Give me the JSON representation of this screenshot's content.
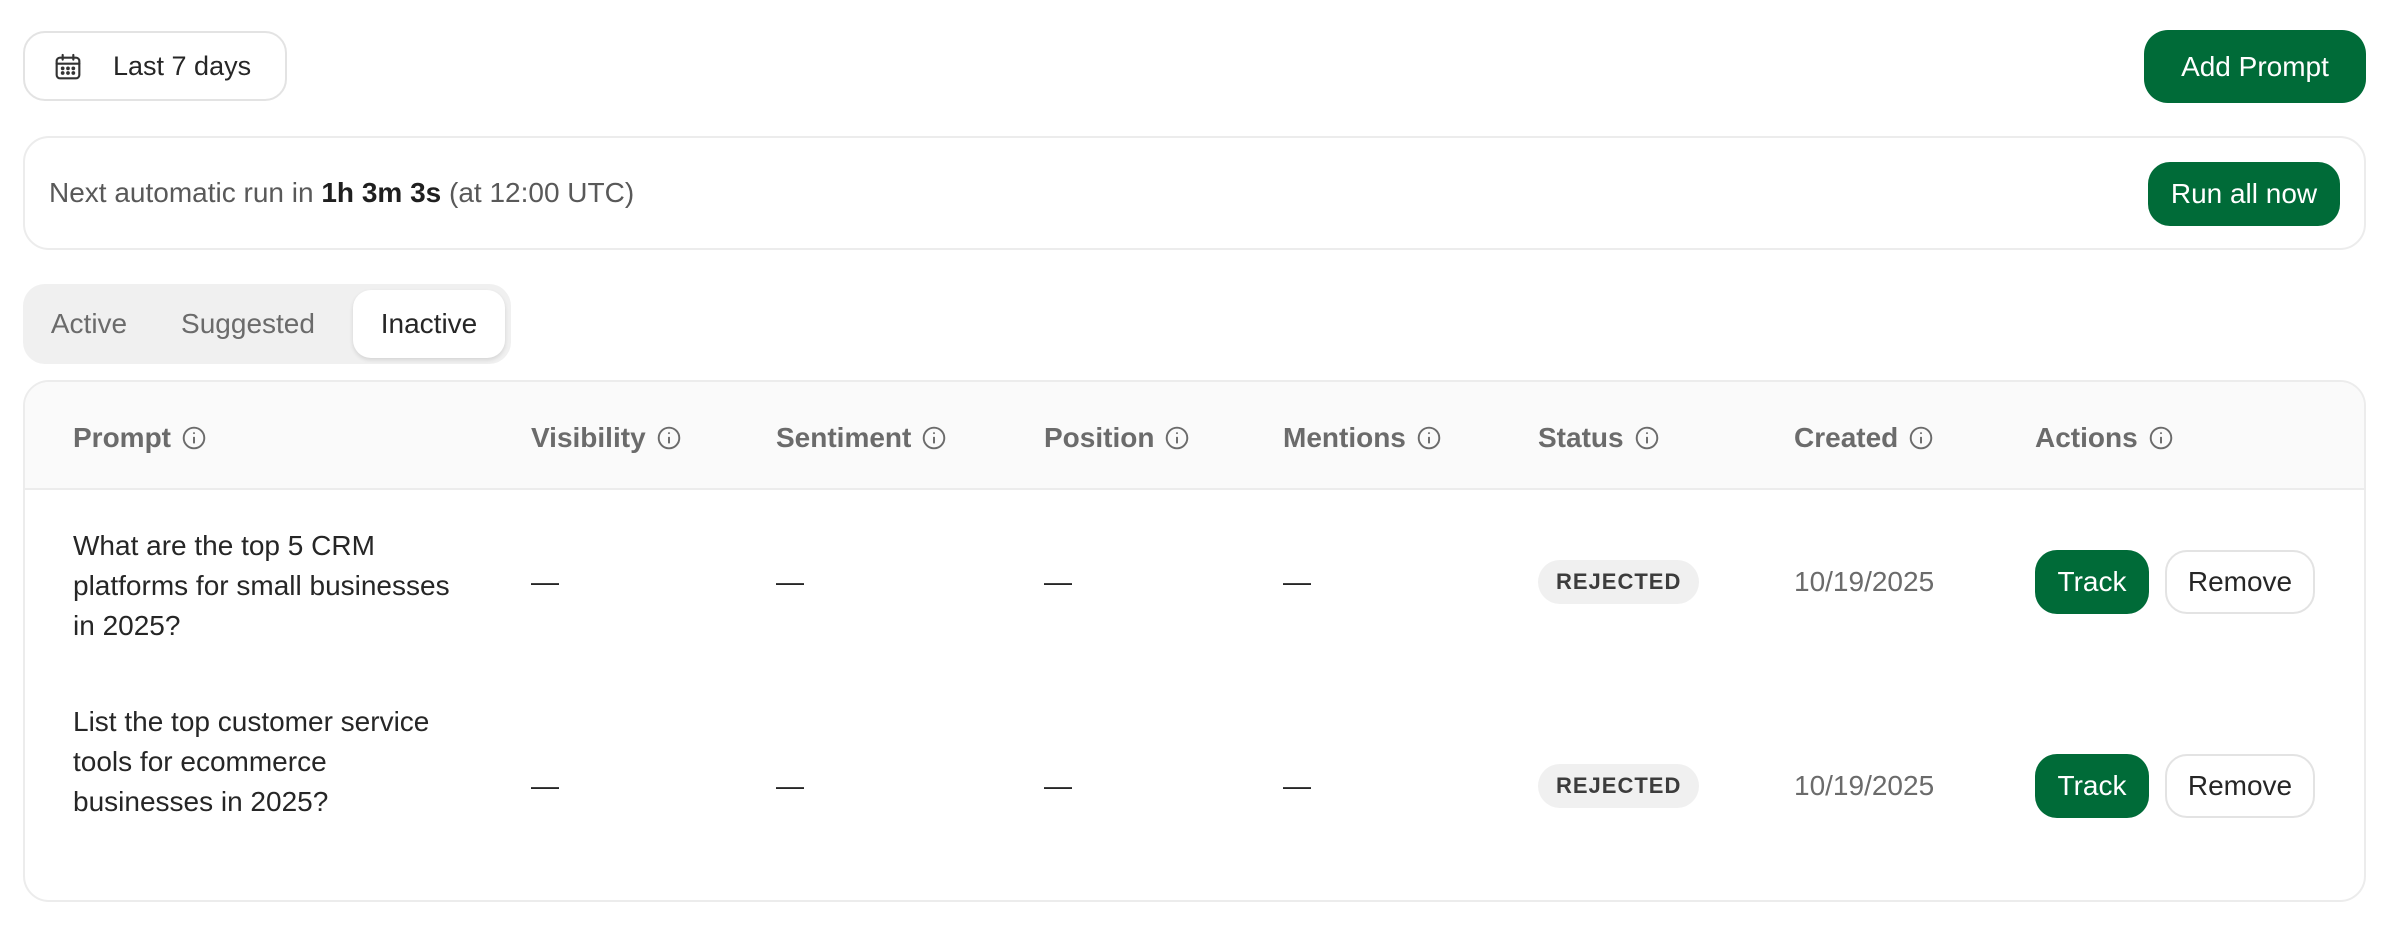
{
  "toolbar": {
    "date_range_label": "Last 7 days",
    "date_icon": "calendar-icon",
    "add_prompt_label": "Add Prompt"
  },
  "schedule": {
    "prefix": "Next automatic run in",
    "countdown": "1h 3m 3s",
    "suffix": "(at 12:00 UTC)",
    "run_all_label": "Run all now"
  },
  "tabs": [
    {
      "label": "Active",
      "selected": false
    },
    {
      "label": "Suggested",
      "selected": false
    },
    {
      "label": "Inactive",
      "selected": true
    }
  ],
  "table": {
    "columns": [
      "Prompt",
      "Visibility",
      "Sentiment",
      "Position",
      "Mentions",
      "Status",
      "Created",
      "Actions"
    ],
    "info_icon": "info-icon",
    "rows": [
      {
        "prompt": "What are the top 5 CRM platforms for small businesses in 2025?",
        "visibility": "—",
        "sentiment": "—",
        "position": "—",
        "mentions": "—",
        "status": "REJECTED",
        "created": "10/19/2025",
        "track_label": "Track",
        "remove_label": "Remove"
      },
      {
        "prompt": "List the top customer service tools for ecommerce businesses in 2025?",
        "visibility": "—",
        "sentiment": "—",
        "position": "—",
        "mentions": "—",
        "status": "REJECTED",
        "created": "10/19/2025",
        "track_label": "Track",
        "remove_label": "Remove"
      }
    ]
  },
  "colors": {
    "primary": "#006b38",
    "badge_bg": "#f0f0f0",
    "border": "#ececec"
  }
}
